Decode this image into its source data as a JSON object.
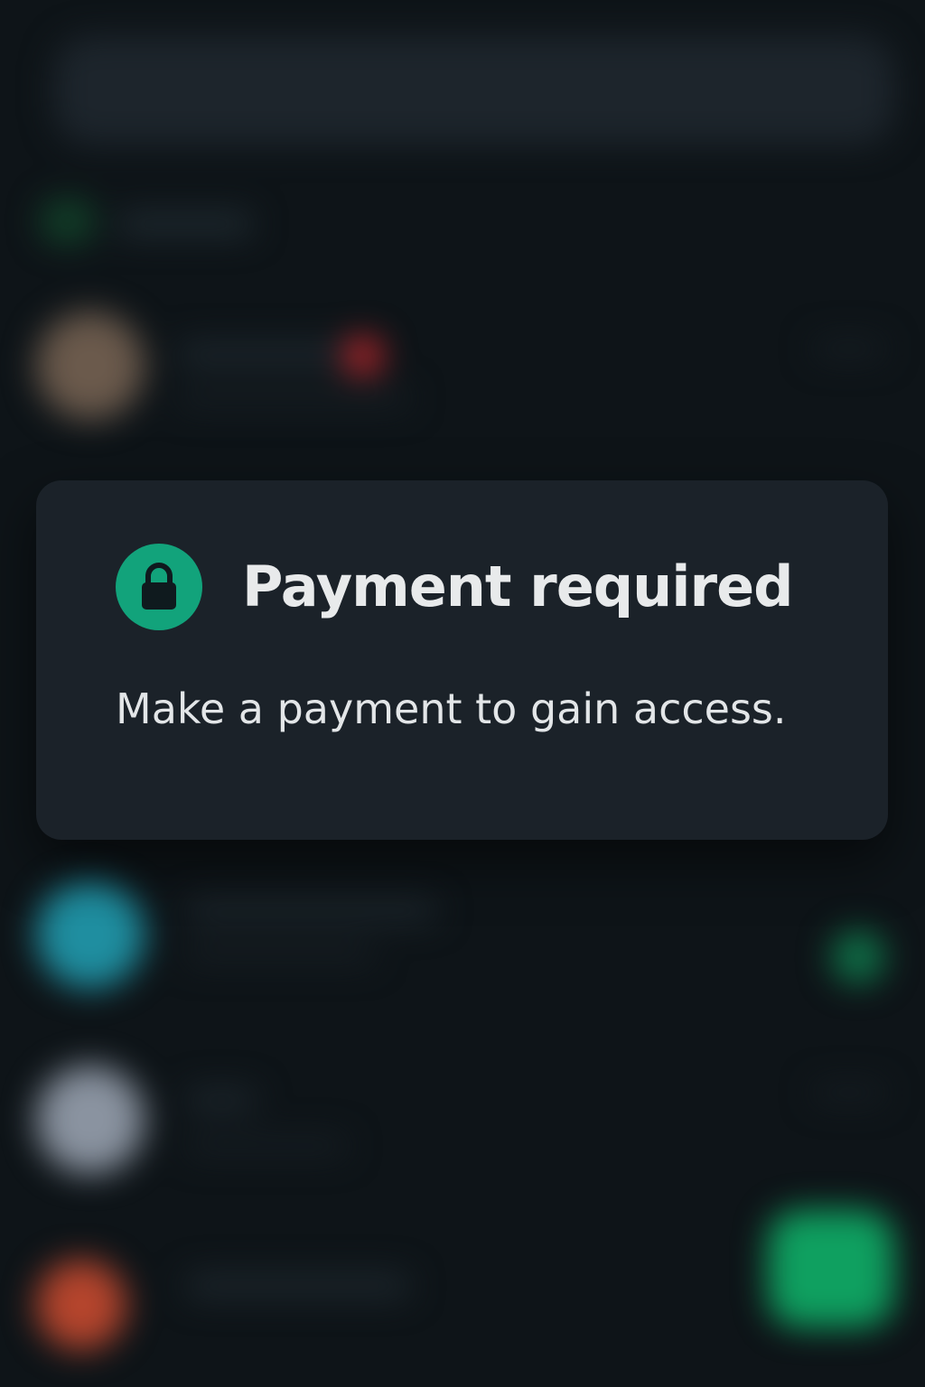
{
  "dialog": {
    "title": "Payment required",
    "message": "Make a payment to gain access.",
    "icon": "lock-icon",
    "accent_color": "#12a37b"
  },
  "background": {
    "conversations": [
      {
        "avatar_color": "#6b5a4c",
        "unread_badge_color": "#b3262b"
      },
      {
        "avatar_color": "#1f8ea0",
        "unread_badge_color": "#12a060"
      },
      {
        "avatar_color": "#8a93a0"
      },
      {
        "avatar_color": "#b5452d"
      }
    ],
    "fab_color": "#0fa060"
  }
}
